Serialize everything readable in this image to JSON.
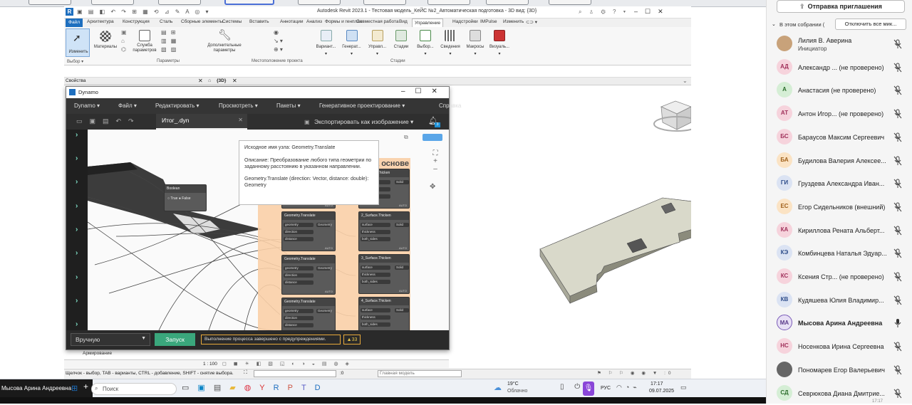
{
  "browser_tabs": [
    {
      "w": 60
    },
    {
      "w": 60
    },
    {
      "w": 60
    },
    {
      "w": 70
    },
    {
      "w": 60
    },
    {
      "w": 60
    },
    {
      "w": 60
    },
    {
      "w": 60
    },
    {
      "w": 60
    }
  ],
  "revit": {
    "title": "Autodesk Revit 2023.1 - Тестовая модель_КеЙС №2_Автоматическая подготовка - 3D вид: {3D}",
    "tabs": [
      "Файл",
      "Архитектура",
      "Конструкция",
      "Сталь",
      "Сборные элементы",
      "Системы",
      "Вставить",
      "Аннотации",
      "Анализ",
      "Формы и генплан",
      "Совместная работа",
      "Вид",
      "Управление",
      "Надстройки",
      "IMPulse",
      "Изменить"
    ],
    "ribbon_buttons": [
      "Изменить",
      "Материалы",
      "Служба параметров",
      "Дополнительные параметры",
      "Вариант...",
      "Генерат...",
      "Управл...",
      "Стадии",
      "Выбор...",
      "Сведения",
      "Макросы",
      "Визуаль..."
    ],
    "groups": [
      "Выбор ▾",
      "Параметры",
      "Местоположение проекта",
      "Стадии"
    ],
    "props_label": "Свойства",
    "view_tab": "{3D}",
    "status_hint": "Щелчок - выбор, TAB - варианты, CTRL - добавление, SHIFT - снятие выбора.",
    "scale": "1 : 100",
    "zero": ":0",
    "model": "Главная модель",
    "armirovanie": "Армирование"
  },
  "dynamo": {
    "title": "Dynamo",
    "menu": [
      "Dynamo ▾",
      "Файл ▾",
      "Редактировать ▾",
      "Просмотреть ▾",
      "Пакеты ▾",
      "Генеративное проектирование ▾",
      "Справка"
    ],
    "file_tab": "Итог_.dyn",
    "export_label": "Экспортировать как изображение ▾",
    "run_mode": "Вручную",
    "run_button": "Запуск",
    "run_status": "Выполнение процесса завершено с предупреждениями.",
    "warnings": "▲33",
    "group_title": "...товка на основе",
    "boolean_title": "Boolean",
    "boolean_true": "True",
    "boolean_false": "False",
    "nodes": [
      {
        "title": "Geometry.Translate",
        "ports": [
          "geometry",
          "direction",
          "distance"
        ],
        "out": "Geometry",
        "lacing": "AUTO"
      },
      {
        "title": "Geometry.Translate",
        "ports": [
          "geometry",
          "direction",
          "distance"
        ],
        "out": "Geometry",
        "lacing": "AUTO"
      },
      {
        "title": "Geometry.Translate",
        "ports": [
          "geometry",
          "direction",
          "distance"
        ],
        "out": "Geometry",
        "lacing": "AUTO"
      },
      {
        "title": "Geometry.Translate",
        "ports": [
          "geometry",
          "direction",
          "distance"
        ],
        "out": "Geometry",
        "lacing": "AUTO"
      }
    ],
    "thicken": [
      {
        "title": "...Surface.Thicken",
        "ports": [
          "surface",
          "thickness",
          "both_sides"
        ],
        "out": "Solid",
        "lacing": "AUTO"
      },
      {
        "title": "2_Surface.Thicken",
        "ports": [
          "surface",
          "thickness",
          "both_sides"
        ],
        "out": "Solid",
        "lacing": "AUTO"
      },
      {
        "title": "3_Surface.Thicken",
        "ports": [
          "surface",
          "thickness",
          "both_sides"
        ],
        "out": "Solid",
        "lacing": "AUTO"
      },
      {
        "title": "4_Surface.Thicken",
        "ports": [
          "surface",
          "thickness",
          "both_sides"
        ],
        "out": "Solid",
        "lacing": "AUTO"
      }
    ],
    "tooltip": {
      "l1": "Исходное имя узла:  Geometry.Translate",
      "l2": "Описание:  Преобразование любого типа геометрии по заданному расстоянию в указанном направлении.",
      "l3": "Geometry.Translate (direction: Vector, distance: double): Geometry"
    },
    "notifications": "3"
  },
  "taskbar": {
    "user": "Мысова Арина Андреевна",
    "search": "Поиск",
    "weather_temp": "19°C",
    "weather_desc": "Облачно",
    "lang": "РУС",
    "time": "17:17",
    "date": "09.07.2025"
  },
  "panel": {
    "invite": "Отправка приглашения",
    "in_meeting": "В этом собрании (",
    "mute_all": "Отключить все мик...",
    "participants": [
      {
        "initials": "",
        "name": "Лилия В. Аверина",
        "sub": "Инициатор",
        "color": "#c8a27a",
        "fg": "#fff",
        "photo": true,
        "mic": "off"
      },
      {
        "initials": "АД",
        "name": "Александр ...  (не проверено)",
        "sub": "",
        "color": "#f6d3dc",
        "fg": "#a0305a",
        "mic": "off"
      },
      {
        "initials": "А",
        "name": "Анастасия (не проверено)",
        "sub": "",
        "color": "#d5eed5",
        "fg": "#2d6e2d",
        "mic": "off"
      },
      {
        "initials": "АТ",
        "name": "Антон Игор...  (не проверено)",
        "sub": "",
        "color": "#f6d3dc",
        "fg": "#a0305a",
        "mic": "off"
      },
      {
        "initials": "БС",
        "name": "Бараусов Максим Сергеевич",
        "sub": "",
        "color": "#f6d3dc",
        "fg": "#a0305a",
        "mic": "off"
      },
      {
        "initials": "БА",
        "name": "Будилова Валерия Алексее...",
        "sub": "",
        "color": "#fbe3c4",
        "fg": "#a0601a",
        "mic": "off"
      },
      {
        "initials": "ГИ",
        "name": "Груздева Александра Иван...",
        "sub": "",
        "color": "#dbe3f3",
        "fg": "#2d4c8a",
        "mic": "off"
      },
      {
        "initials": "ЕС",
        "name": "Егор Сидельников (внешний)",
        "sub": "",
        "color": "#fbe3c4",
        "fg": "#a0601a",
        "mic": "off"
      },
      {
        "initials": "КА",
        "name": "Кириллова Рената Альберт...",
        "sub": "",
        "color": "#f6d3dc",
        "fg": "#a0305a",
        "mic": "off"
      },
      {
        "initials": "КЭ",
        "name": "Комбинцева Наталья Эдуар...",
        "sub": "",
        "color": "#dbe3f3",
        "fg": "#2d4c8a",
        "mic": "off"
      },
      {
        "initials": "КС",
        "name": "Ксения Стр...  (не проверено)",
        "sub": "",
        "color": "#f6d3dc",
        "fg": "#a0305a",
        "mic": "off"
      },
      {
        "initials": "КВ",
        "name": "Кудяшева Юлия Владимир...",
        "sub": "",
        "color": "#dbe3f3",
        "fg": "#2d4c8a",
        "mic": "off"
      },
      {
        "initials": "МА",
        "name": "Мысова Арина Андреевна",
        "sub": "",
        "color": "#e8e0f5",
        "fg": "#5a3a8a",
        "mic": "on"
      },
      {
        "initials": "НС",
        "name": "Носенкова Ирина Сергеевна",
        "sub": "",
        "color": "#f6d3dc",
        "fg": "#a0305a",
        "mic": "off"
      },
      {
        "initials": "",
        "name": "Пономарев Егор Валерьевич",
        "sub": "",
        "color": "#666",
        "fg": "#fff",
        "photo": true,
        "mic": "off"
      },
      {
        "initials": "СД",
        "name": "Севрюкова Диана Дмитрие...",
        "sub": "",
        "color": "#d5eed5",
        "fg": "#2d6e2d",
        "mic": "off"
      }
    ],
    "bottom_time": "17:17"
  }
}
